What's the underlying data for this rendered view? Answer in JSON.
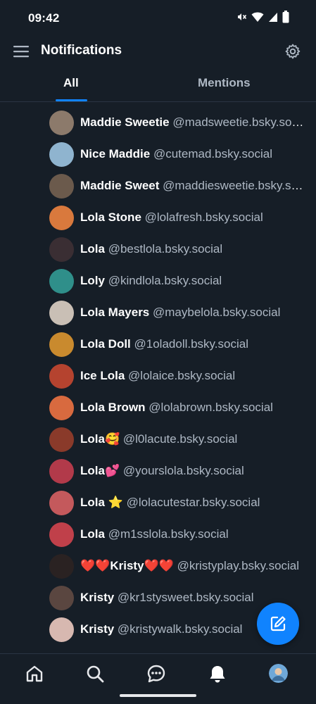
{
  "status_bar": {
    "time": "09:42"
  },
  "header": {
    "title": "Notifications"
  },
  "tabs": [
    {
      "label": "All",
      "active": true
    },
    {
      "label": "Mentions",
      "active": false
    }
  ],
  "notifications": [
    {
      "name": "Maddie Sweetie",
      "handle": "@madsweetie.bsky.social",
      "avatar_color": "#8c7a6b"
    },
    {
      "name": "Nice Maddie",
      "handle": "@cutemad.bsky.social",
      "avatar_color": "#8fb4cf"
    },
    {
      "name": "Maddie Sweet",
      "handle": "@maddiesweetie.bsky.social",
      "avatar_color": "#6b5a4c"
    },
    {
      "name": "Lola Stone",
      "handle": "@lolafresh.bsky.social",
      "avatar_color": "#d9793d"
    },
    {
      "name": "Lola",
      "handle": "@bestlola.bsky.social",
      "avatar_color": "#3a2e33"
    },
    {
      "name": "Loly",
      "handle": "@kindlola.bsky.social",
      "avatar_color": "#2f8f8a"
    },
    {
      "name": "Lola Mayers",
      "handle": "@maybelola.bsky.social",
      "avatar_color": "#c9bfb5"
    },
    {
      "name": "Lola Doll",
      "handle": "@1oladoll.bsky.social",
      "avatar_color": "#c98a2e"
    },
    {
      "name": "Ice Lola",
      "handle": "@lolaice.bsky.social",
      "avatar_color": "#b5432f"
    },
    {
      "name": "Lola Brown",
      "handle": "@lolabrown.bsky.social",
      "avatar_color": "#d86a3f"
    },
    {
      "name": "Lola🥰",
      "handle": "@l0lacute.bsky.social",
      "avatar_color": "#8a3a2a"
    },
    {
      "name": "Lola💕",
      "handle": "@yourslola.bsky.social",
      "avatar_color": "#b23a4a"
    },
    {
      "name": "Lola ⭐",
      "handle": "@lolacutestar.bsky.social",
      "avatar_color": "#c4595c"
    },
    {
      "name": "Lola",
      "handle": "@m1sslola.bsky.social",
      "avatar_color": "#c0404a"
    },
    {
      "name": "❤️❤️Kristy❤️❤️",
      "handle": "@kristyplay.bsky.social",
      "avatar_color": "#2a2222"
    },
    {
      "name": "Kristy",
      "handle": "@kr1stysweet.bsky.social",
      "avatar_color": "#5a4640"
    },
    {
      "name": "Kristy",
      "handle": "@kristywalk.bsky.social",
      "avatar_color": "#d7b8b0"
    }
  ],
  "colors": {
    "accent": "#1083fe",
    "background": "#161e27",
    "text_secondary": "#aeb8c4"
  },
  "icons": {
    "menu": "menu-icon",
    "settings": "gear-icon",
    "compose": "compose-icon",
    "home": "home-icon",
    "search": "search-icon",
    "chat": "chat-icon",
    "notifications": "bell-icon",
    "profile": "profile-avatar"
  }
}
